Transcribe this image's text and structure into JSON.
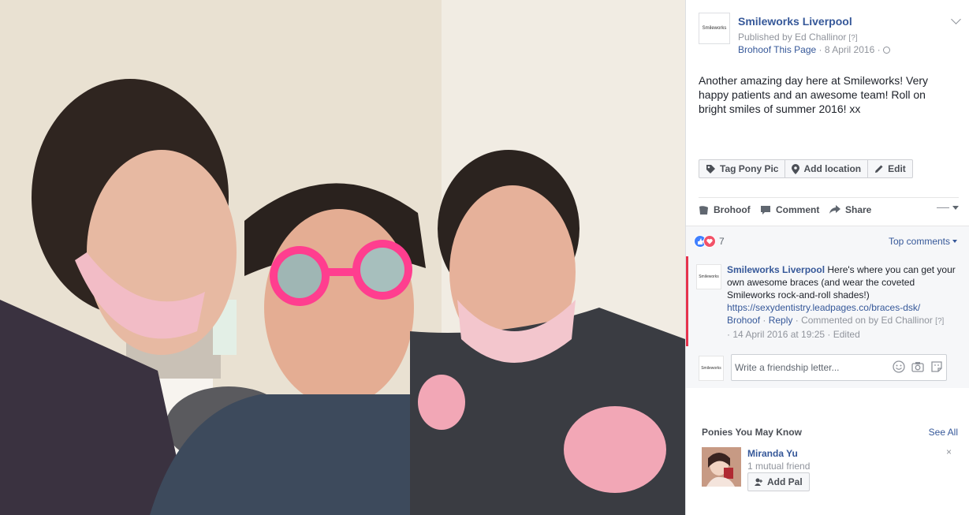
{
  "photo": {
    "alt_icon": "photo-image"
  },
  "post": {
    "page_name": "Smileworks Liverpool",
    "logo_text": "Smileworks",
    "published_by": "Published by Ed Challinor",
    "published_q": "[?]",
    "brohoof_page": "Brohoof This Page",
    "date": "· 8 April 2016 ·",
    "body": "Another amazing day here at Smileworks! Very happy patients and an awesome team! Roll on bright smiles of summer 2016! xx"
  },
  "edit_bar": {
    "tag": "Tag Pony Pic",
    "location": "Add location",
    "edit": "Edit"
  },
  "actions": {
    "brohoof": "Brohoof",
    "comment": "Comment",
    "share": "Share"
  },
  "reactions": {
    "count": "7",
    "top_comments": "Top comments"
  },
  "comment": {
    "author": "Smileworks Liverpool",
    "text": " Here's where you can get your own awesome braces (and wear the coveted Smileworks rock-and-roll shades!)",
    "link": "https://sexydentistry.leadpages.co/braces-dsk/",
    "brohoof": "Brohoof",
    "reply": "Reply",
    "commented_on_by": "· Commented on by Ed Challinor",
    "q": "[?]",
    "timestamp": "· 14 April 2016 at 19:25 · Edited"
  },
  "write": {
    "placeholder": "Write a friendship letter..."
  },
  "pymk": {
    "title": "Ponies You May Know",
    "see_all": "See All",
    "name": "Miranda Yu",
    "mutual": "1 mutual friend",
    "add": "Add Pal",
    "close": "×"
  },
  "colors": {
    "link": "#365899",
    "accent_red": "#e6334c",
    "like_blue": "#4080ff",
    "love_red": "#f25268"
  }
}
